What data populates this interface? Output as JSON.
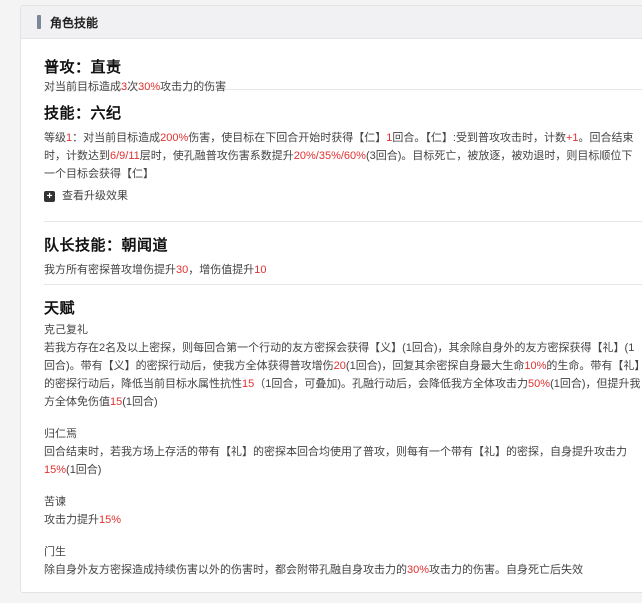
{
  "panel": {
    "title": "角色技能"
  },
  "normal_attack": {
    "title": "普攻：直责",
    "desc": [
      {
        "t": "对当前目标造成"
      },
      {
        "t": "3",
        "r": true
      },
      {
        "t": "次"
      },
      {
        "t": "30%",
        "r": true
      },
      {
        "t": "攻击力的伤害"
      }
    ]
  },
  "skill": {
    "title": "技能：六纪",
    "desc": [
      {
        "t": "等级"
      },
      {
        "t": "1",
        "r": true
      },
      {
        "t": "：对当前目标造成"
      },
      {
        "t": "200%",
        "r": true
      },
      {
        "t": "伤害，使目标在下回合开始时获得【仁】"
      },
      {
        "t": "1",
        "r": true
      },
      {
        "t": "回合。【仁】:受到普攻攻击时，计数"
      },
      {
        "t": "+1",
        "r": true
      },
      {
        "t": "。回合结束时，计数达到"
      },
      {
        "t": "6/9/11",
        "r": true
      },
      {
        "t": "层时，使孔融普攻伤害系数提升"
      },
      {
        "t": "20%/35%/60%",
        "r": true
      },
      {
        "t": "(3回合)。目标死亡，被放逐，被劝退时，则目标顺位下一个目标会获得【仁】"
      }
    ],
    "upgrade_icon": "plus-square-icon",
    "upgrade_label": "查看升级效果"
  },
  "leader_skill": {
    "title": "队长技能：朝闻道",
    "desc": [
      {
        "t": "我方所有密探普攻增伤提升"
      },
      {
        "t": "30",
        "r": true
      },
      {
        "t": "，增伤值提升"
      },
      {
        "t": "10",
        "r": true
      }
    ]
  },
  "talents": {
    "title": "天赋",
    "items": [
      {
        "name": "克己复礼",
        "desc": [
          {
            "t": "若我方存在2名及以上密探，则每回合第一个行动的友方密探会获得【义】(1回合)，其余除自身外的友方密探获得【礼】(1回合)。带有【义】的密探行动后，使我方全体获得普攻增伤"
          },
          {
            "t": "20",
            "r": true
          },
          {
            "t": "(1回合)，回复其余密探自身最大生命"
          },
          {
            "t": "10%",
            "r": true
          },
          {
            "t": "的生命。带有【礼】的密探行动后，降低当前目标水属性抗性"
          },
          {
            "t": "15",
            "r": true
          },
          {
            "t": "（1回合，可叠加)。孔融行动后，会降低我方全体攻击力"
          },
          {
            "t": "50%",
            "r": true
          },
          {
            "t": "(1回合)，但提升我方全体免伤值"
          },
          {
            "t": "15",
            "r": true
          },
          {
            "t": "(1回合)"
          }
        ]
      },
      {
        "name": "归仁焉",
        "desc": [
          {
            "t": "回合结束时，若我方场上存活的带有【礼】的密探本回合均使用了普攻，则每有一个带有【礼】的密探，自身提升攻击力"
          },
          {
            "t": "15%",
            "r": true
          },
          {
            "t": "(1回合)"
          }
        ]
      },
      {
        "name": "苦谏",
        "desc": [
          {
            "t": "攻击力提升"
          },
          {
            "t": "15%",
            "r": true
          }
        ]
      },
      {
        "name": "门生",
        "desc": [
          {
            "t": "除自身外友方密探造成持续伤害以外的伤害时，都会附带孔融自身攻击力的"
          },
          {
            "t": "30%",
            "r": true
          },
          {
            "t": "攻击力的伤害。自身死亡后失效"
          }
        ]
      }
    ]
  },
  "colors": {
    "highlight": "#e03131",
    "header_bar": "#7a8699",
    "header_bg": "#f1f1f3"
  }
}
